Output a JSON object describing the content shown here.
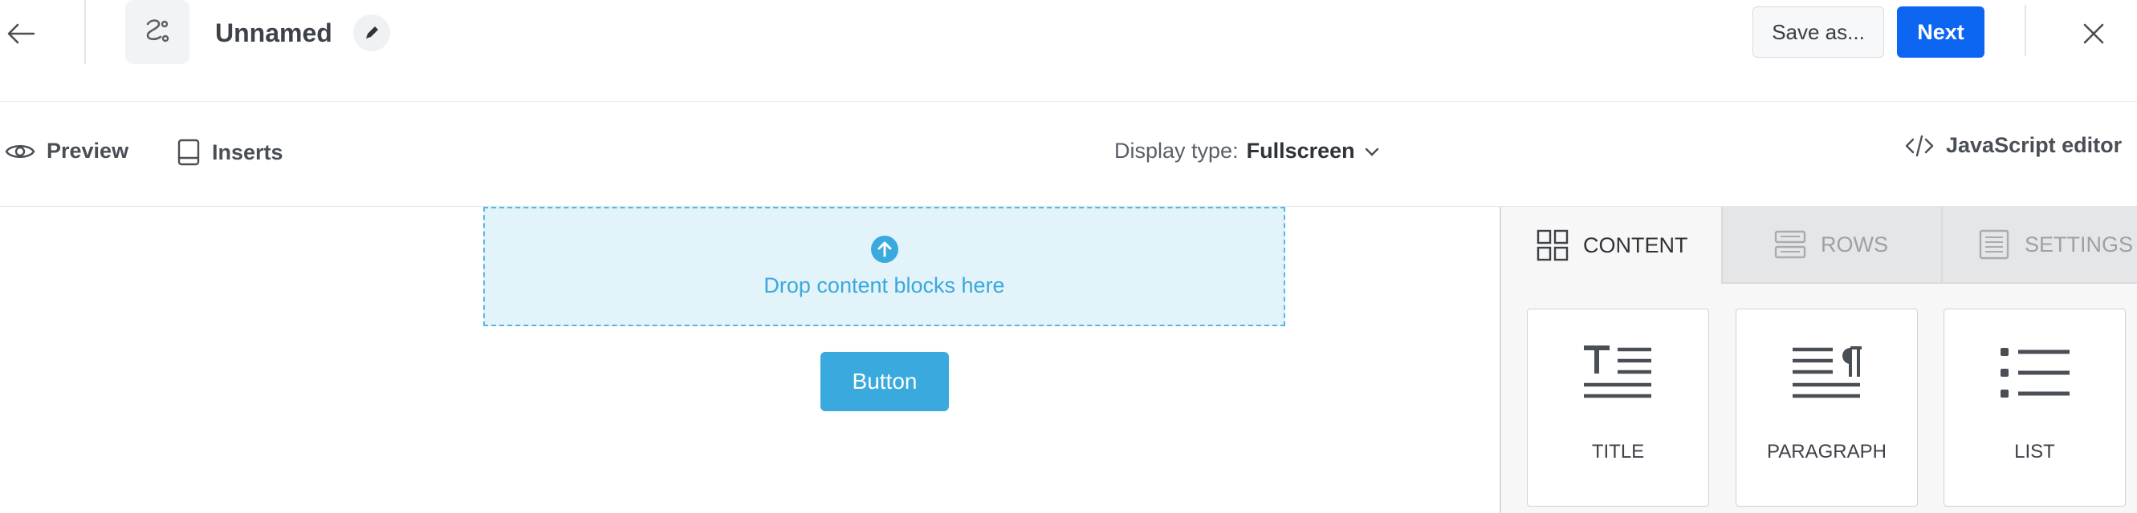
{
  "header": {
    "title": "Unnamed",
    "save_as_label": "Save as...",
    "next_label": "Next"
  },
  "toolbar": {
    "preview_label": "Preview",
    "inserts_label": "Inserts",
    "display_type_label": "Display type:",
    "display_type_value": "Fullscreen",
    "js_editor_label": "JavaScript editor"
  },
  "canvas": {
    "dropzone_text": "Drop content blocks here",
    "button_label": "Button"
  },
  "panel": {
    "tabs": [
      {
        "label": "CONTENT",
        "active": true
      },
      {
        "label": "ROWS",
        "active": false
      },
      {
        "label": "SETTINGS",
        "active": false
      }
    ],
    "blocks": [
      {
        "label": "TITLE",
        "icon": "title-icon"
      },
      {
        "label": "PARAGRAPH",
        "icon": "paragraph-icon"
      },
      {
        "label": "LIST",
        "icon": "list-icon"
      }
    ]
  },
  "colors": {
    "primary": "#0d66f2",
    "accent": "#3aa9de",
    "dropzone_bg": "#e3f3fa"
  }
}
